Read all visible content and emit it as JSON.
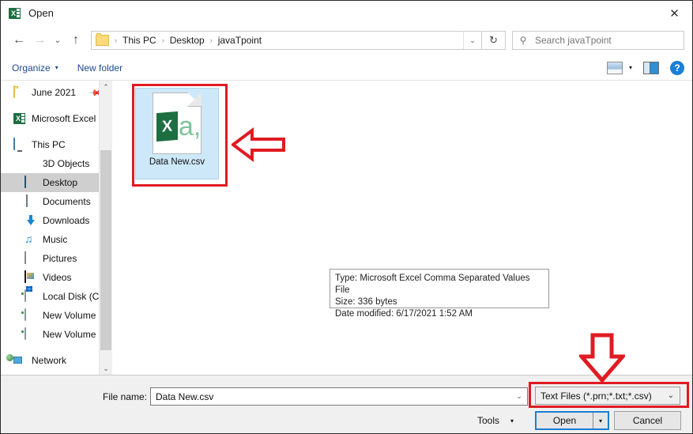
{
  "window": {
    "title": "Open",
    "app_icon": "excel-icon",
    "close_label": "✕"
  },
  "address_bar": {
    "back_label": "←",
    "forward_label": "→",
    "recent_label": "⌄",
    "up_label": "↑",
    "breadcrumb": [
      "This PC",
      "Desktop",
      "javaTpoint"
    ],
    "separator": "›",
    "dropdown_caret": "⌄",
    "refresh_label": "↻",
    "search": {
      "placeholder": "Search javaTpoint",
      "value": "",
      "icon": "search-icon"
    }
  },
  "command_bar": {
    "organize_label": "Organize",
    "organize_caret": "▾",
    "new_folder_label": "New folder",
    "view_caret": "▾",
    "help_label": "?"
  },
  "sidebar": {
    "items": [
      {
        "label": "June 2021",
        "icon": "folder-icon",
        "level": 0,
        "pinned": true,
        "selected": false
      },
      {
        "label": "Microsoft Excel",
        "icon": "excel-icon",
        "level": 0,
        "pinned": false,
        "selected": false
      },
      {
        "label": "This PC",
        "icon": "this-pc-icon",
        "level": 0,
        "pinned": false,
        "selected": false
      },
      {
        "label": "3D Objects",
        "icon": "3d-objects-icon",
        "level": 1,
        "pinned": false,
        "selected": false
      },
      {
        "label": "Desktop",
        "icon": "desktop-icon",
        "level": 1,
        "pinned": false,
        "selected": true
      },
      {
        "label": "Documents",
        "icon": "documents-icon",
        "level": 1,
        "pinned": false,
        "selected": false
      },
      {
        "label": "Downloads",
        "icon": "downloads-icon",
        "level": 1,
        "pinned": false,
        "selected": false
      },
      {
        "label": "Music",
        "icon": "music-icon",
        "level": 1,
        "pinned": false,
        "selected": false
      },
      {
        "label": "Pictures",
        "icon": "pictures-icon",
        "level": 1,
        "pinned": false,
        "selected": false
      },
      {
        "label": "Videos",
        "icon": "videos-icon",
        "level": 1,
        "pinned": false,
        "selected": false
      },
      {
        "label": "Local Disk (C:)",
        "icon": "local-disk-icon",
        "level": 1,
        "pinned": false,
        "selected": false
      },
      {
        "label": "New Volume (E:)",
        "icon": "drive-icon",
        "level": 1,
        "pinned": false,
        "selected": false
      },
      {
        "label": "New Volume (F:)",
        "icon": "drive-icon",
        "level": 1,
        "pinned": false,
        "selected": false
      },
      {
        "label": "Network",
        "icon": "network-icon",
        "level": 0,
        "pinned": false,
        "selected": false
      }
    ],
    "scroll_up": "⌃",
    "scroll_down": "⌄"
  },
  "content": {
    "file": {
      "name": "Data New.csv",
      "icon": "csv-file-icon",
      "icon_letter": "X",
      "icon_secondary": "a,",
      "selected": true
    },
    "tooltip": {
      "type_line": "Type: Microsoft Excel Comma Separated Values File",
      "size_line": "Size: 336 bytes",
      "date_line": "Date modified: 6/17/2021 1:52 AM"
    }
  },
  "footer": {
    "filename_label": "File name:",
    "filename_value": "Data New.csv",
    "filename_placeholder": "",
    "filename_caret": "⌄",
    "filetype_value": "Text Files (*.prn;*.txt;*.csv)",
    "filetype_caret": "⌄",
    "tools_label": "Tools",
    "tools_caret": "▾",
    "open_label": "Open",
    "open_caret": "▾",
    "cancel_label": "Cancel"
  },
  "annotations": {
    "accent_color": "#e01b22",
    "arrow_left_name": "red-left-arrow-annotation",
    "arrow_down_name": "red-down-arrow-annotation",
    "box_file_name": "red-highlight-box-file",
    "box_filetype_name": "red-highlight-box-filetype"
  }
}
